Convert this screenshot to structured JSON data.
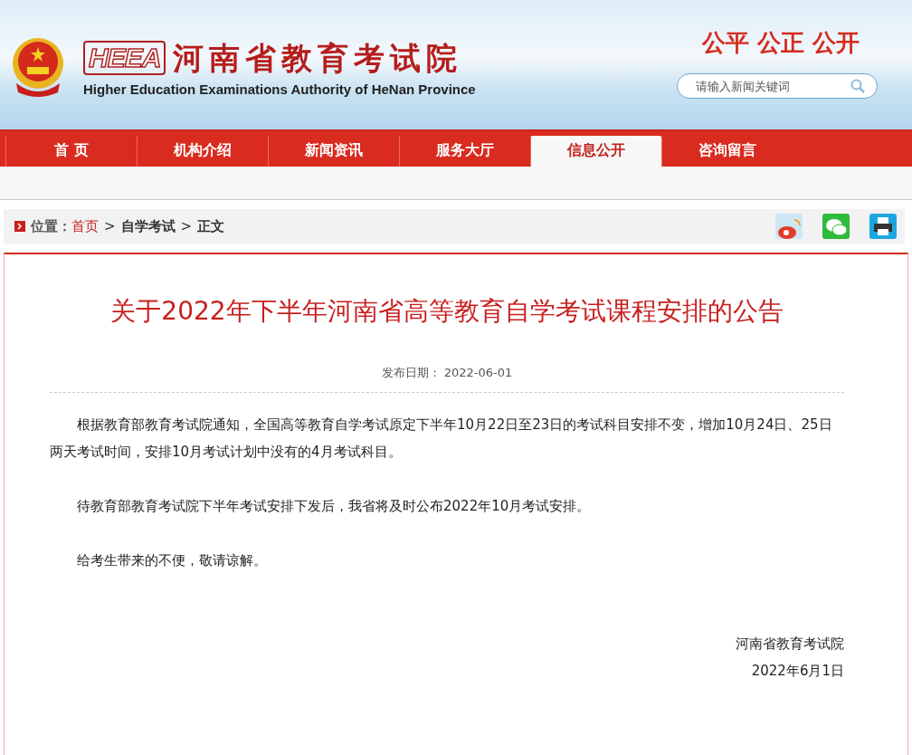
{
  "header": {
    "logo_mark": "HEEA",
    "title": "河南省教育考试院",
    "subtitle": "Higher Education Examinations Authority of HeNan Province",
    "slogan": "公平 公正 公开",
    "search": {
      "placeholder": "请输入新闻关键词"
    }
  },
  "nav": [
    {
      "label": "首 页",
      "selected": false
    },
    {
      "label": "机构介绍",
      "selected": false
    },
    {
      "label": "新闻资讯",
      "selected": false
    },
    {
      "label": "服务大厅",
      "selected": false
    },
    {
      "label": "信息公开",
      "selected": true
    },
    {
      "label": "咨询留言",
      "selected": false
    }
  ],
  "breadcrumb": {
    "prefix": "位置：",
    "items": [
      {
        "label": "首页",
        "kind": "link"
      },
      {
        "label": "自学考试",
        "kind": "plain"
      },
      {
        "label": "正文",
        "kind": "plain"
      }
    ],
    "separator": ">"
  },
  "article": {
    "title": "关于2022年下半年河南省高等教育自学考试课程安排的公告",
    "date_label": "发布日期：",
    "date": "2022-06-01",
    "paragraphs": [
      "根据教育部教育考试院通知，全国高等教育自学考试原定下半年10月22日至23日的考试科目安排不变，增加10月24日、25日两天考试时间，安排10月考试计划中没有的4月考试科目。",
      "待教育部教育考试院下半年考试安排下发后，我省将及时公布2022年10月考试安排。",
      "给考生带来的不便，敬请谅解。"
    ],
    "signature": [
      "河南省教育考试院",
      "2022年6月1日"
    ]
  }
}
